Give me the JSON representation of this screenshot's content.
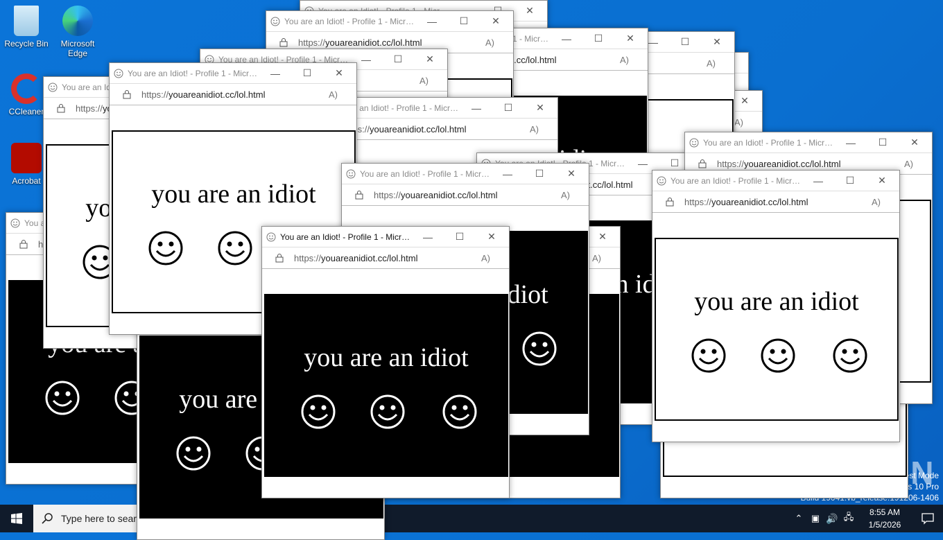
{
  "desktop": {
    "icons": [
      {
        "label": "Recycle Bin"
      },
      {
        "label": "Microsoft Edge"
      },
      {
        "label": "CCleaner"
      },
      {
        "label": "Acrobat"
      }
    ],
    "watermark": {
      "line1": "Test Mode",
      "line2": "Windows 10 Pro",
      "line3": "Build 19041.vb_release.191206-1406"
    },
    "anyrun_logo": "ANY.RUN"
  },
  "popup": {
    "title": "You are an Idiot! - Profile 1 - Microsoft Edge",
    "url_prefix": "https://",
    "url_rest": "youareanidiot.cc/lol.html",
    "message": "you are an idiot",
    "minimize": "—",
    "maximize": "☐",
    "close": "✕",
    "read_aloud": "A)"
  },
  "windows": [
    {
      "theme": "light"
    },
    {
      "theme": "light"
    },
    {
      "theme": "light"
    },
    {
      "theme": "light"
    },
    {
      "theme": "dark"
    },
    {
      "theme": "light"
    },
    {
      "theme": "light"
    },
    {
      "theme": "light"
    },
    {
      "theme": "dark"
    },
    {
      "theme": "light"
    },
    {
      "theme": "dark"
    },
    {
      "theme": "light"
    },
    {
      "theme": "dark"
    },
    {
      "theme": "dark"
    },
    {
      "theme": "dark"
    },
    {
      "theme": "light"
    },
    {
      "theme": "light"
    },
    {
      "theme": "light"
    },
    {
      "theme": "dark"
    }
  ],
  "taskbar": {
    "search_placeholder": "Type here to search",
    "time": "8:55 AM",
    "date": "1/5/2026"
  }
}
